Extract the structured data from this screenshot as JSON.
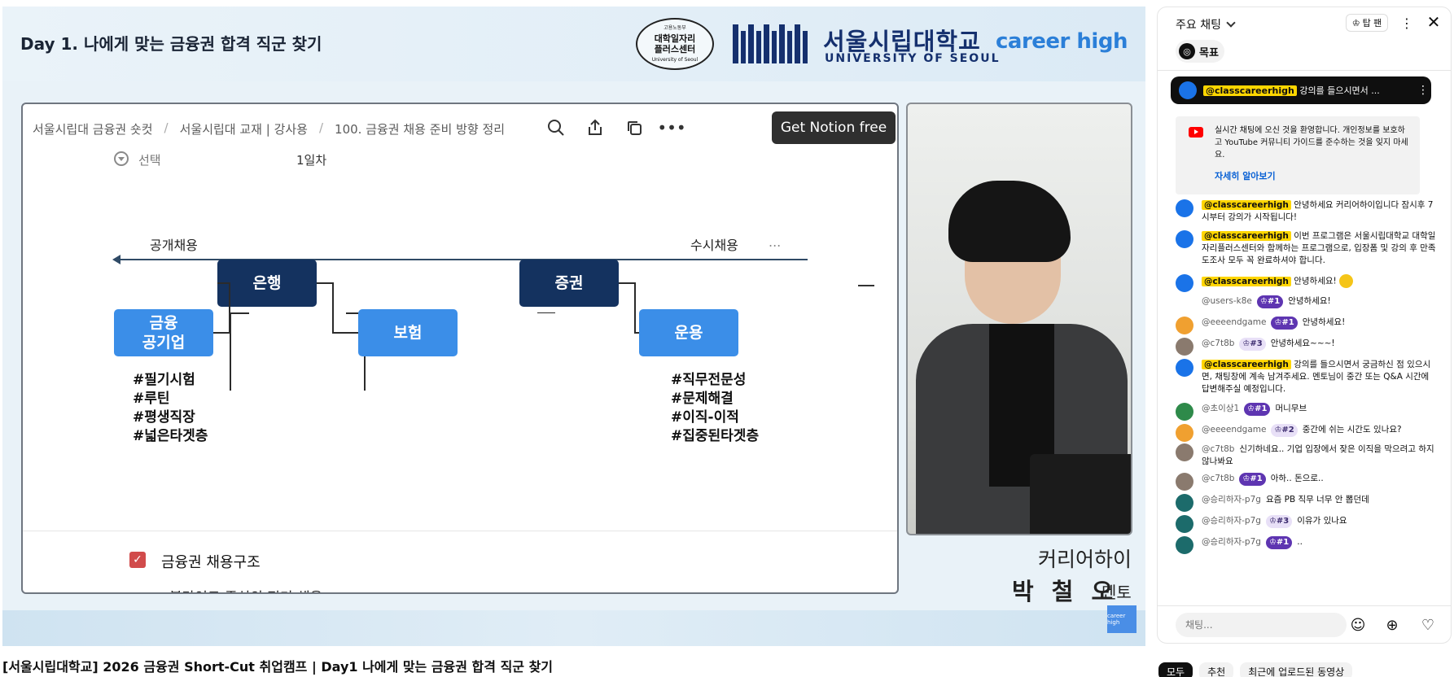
{
  "video": {
    "banner_title": "Day 1. 나에게 맞는 금융권 합격 직군 찾기",
    "seal_top": "고용노동부",
    "seal_line1": "대학일자리",
    "seal_line2": "플러스센터",
    "seal_bottom": "University of Seoul",
    "uos_name_ko": "서울시립대학교",
    "uos_name_en": "UNIVERSITY OF SEOUL",
    "career_logo": "career high",
    "notion": {
      "breadcrumbs": [
        "서울시립대 금융권 숏컷",
        "서울시립대 교재 | 강사용",
        "100. 금융권 채용 준비 방향 정리"
      ],
      "get_notion_label": "Get Notion free",
      "property_name": "선택",
      "property_value": "1일차",
      "label_open": "공개채용",
      "label_rolling": "수시채용",
      "more_label": "...",
      "boxes": {
        "bank": "은행",
        "public": "금융\n공기업",
        "insurance": "보험",
        "securities": "증권",
        "asset": "운용"
      },
      "tags_left": [
        "#필기시험",
        "#루틴",
        "#평생직장",
        "#넓은타겟층"
      ],
      "tags_right": [
        "#직무전문성",
        "#문제해결",
        "#이직-이적",
        "#집중된타겟층"
      ],
      "checkbox_label": "금융권 채용구조",
      "cut_text": "블라인드 중심의 정기 채용"
    },
    "speaker_company": "커리어하이",
    "speaker_name": "박 철 오",
    "speaker_role": "멘토",
    "watermark": "career high"
  },
  "video_title": "[서울시립대학교] 2026 금융권 Short-Cut 취업캠프 | Day1 나에게 맞는 금융권 합격 직군 찾기",
  "chat": {
    "title": "주요 채팅",
    "top_fan": "탑 팬",
    "goal": "목표",
    "pinned": {
      "author": "@classcareerhigh",
      "text": "강의를 들으시면서 ..."
    },
    "welcome_text": "실시간 채팅에 오신 것을 환영합니다. 개인정보를 보호하고 YouTube 커뮤니티 가이드를 준수하는 것을 잊지 마세요.",
    "learn_more": "자세히 알아보기",
    "messages": [
      {
        "author": "@classcareerhigh",
        "highlight": true,
        "badge": "",
        "text": "안녕하세요 커리어하이입니다 잠시후 7시부터 강의가 시작됩니다!"
      },
      {
        "author": "@classcareerhigh",
        "highlight": true,
        "badge": "",
        "text": "이번 프로그램은 서울시립대학교 대학일자리플러스센터와 함께하는 프로그램으로, 입장폼 및 강의 후 만족도조사 모두 꼭 완료하셔야 합니다."
      },
      {
        "author": "@classcareerhigh",
        "highlight": true,
        "badge": "",
        "text": "안녕하세요!"
      },
      {
        "author": "@users-k8e",
        "highlight": false,
        "badge": "#1",
        "text": "안녕하세요!"
      },
      {
        "author": "@eeeendgame",
        "highlight": false,
        "badge": "#1",
        "text": "안녕하세요!"
      },
      {
        "author": "@c7t8b",
        "highlight": false,
        "badge": "#3",
        "text": "안녕하세요~~~!"
      },
      {
        "author": "@classcareerhigh",
        "highlight": true,
        "badge": "",
        "text": "강의를 들으시면서 궁금하신 점 있으시면, 채팅창에 계속 남겨주세요. 멘토님이 중간 또는 Q&A 시간에 답변해주실 예정입니다."
      },
      {
        "author": "@초이상1",
        "highlight": false,
        "badge": "#1",
        "text": "머니무브"
      },
      {
        "author": "@eeeendgame",
        "highlight": false,
        "badge": "#2",
        "text": "중간에 쉬는 시간도 있나요?"
      },
      {
        "author": "@c7t8b",
        "highlight": false,
        "badge": "",
        "text": "신기하네요.. 기업 입장에서 잦은 이직을 막으려고 하지 않나봐요"
      },
      {
        "author": "@c7t8b",
        "highlight": false,
        "badge": "#1",
        "text": "아하.. 돈으로.."
      },
      {
        "author": "@승리하자-p7g",
        "highlight": false,
        "badge": "",
        "text": "요즘 PB 직무 너무 안 뽑던데"
      },
      {
        "author": "@승리하자-p7g",
        "highlight": false,
        "badge": "#3",
        "text": "이유가 있나요"
      },
      {
        "author": "@승리하자-p7g",
        "highlight": false,
        "badge": "#1",
        "text": ".."
      }
    ],
    "input_placeholder": "채팅..."
  },
  "chips": [
    "모두",
    "추천",
    "최근에 업로드된 동영상"
  ]
}
